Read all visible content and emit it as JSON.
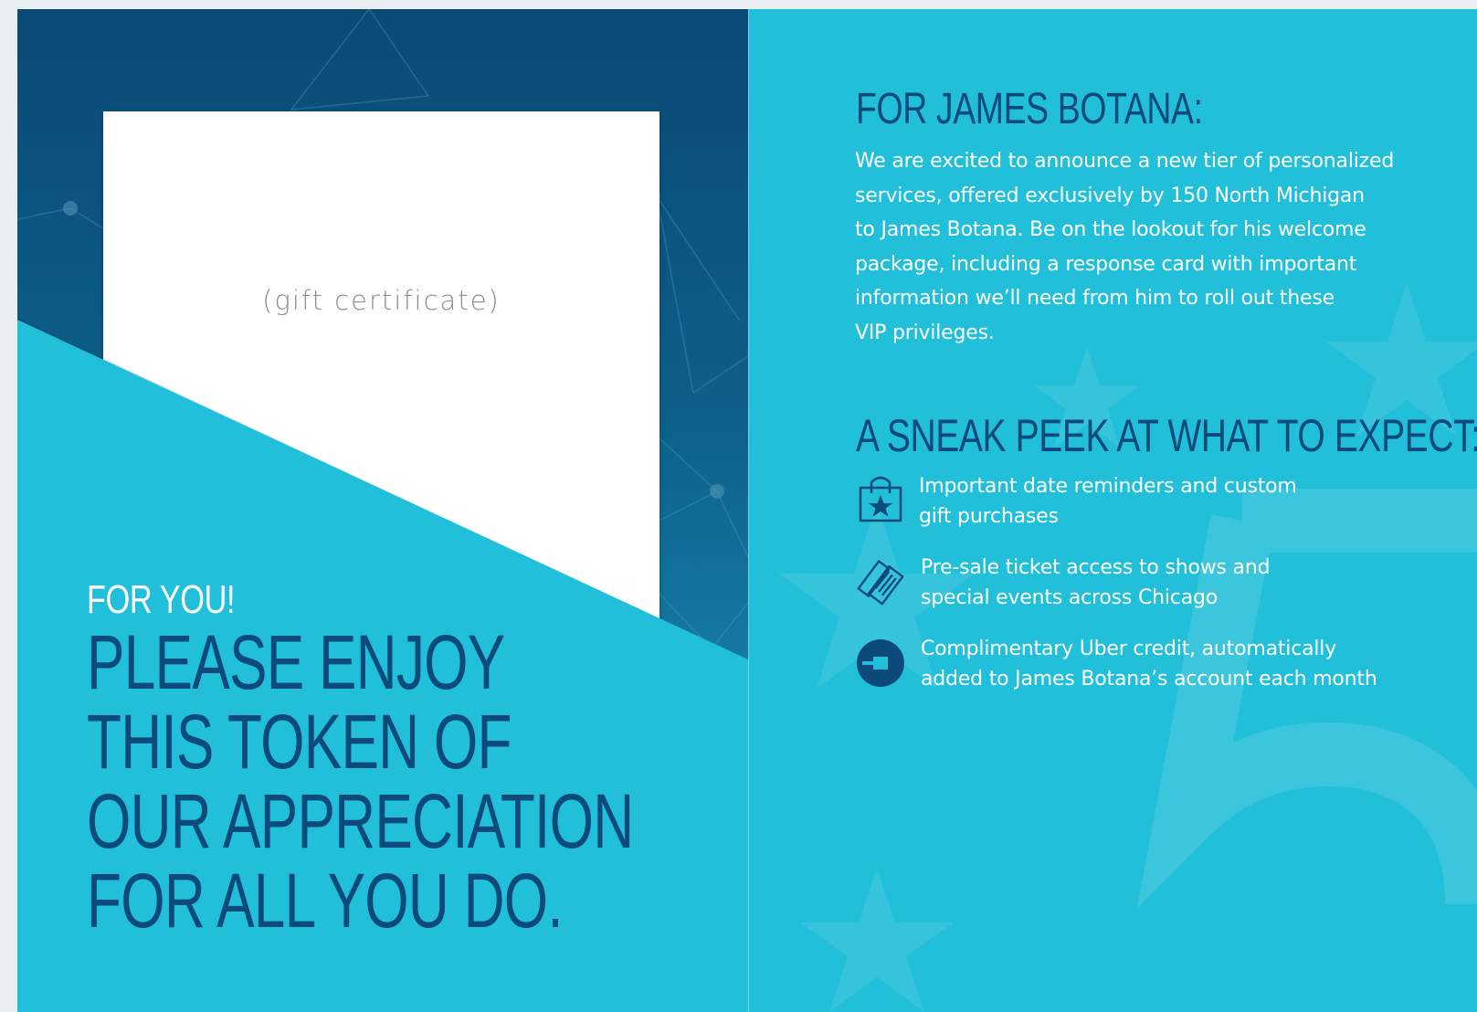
{
  "left": {
    "certificate_label": "(gift certificate)",
    "for_you": "FOR YOU!",
    "headline_lines": [
      "PLEASE ENJOY",
      "THIS TOKEN OF",
      "OUR APPRECIATION",
      "FOR ALL YOU DO."
    ]
  },
  "right": {
    "heading": "FOR JAMES BOTANA:",
    "intro_lines": [
      "We are excited to announce a new tier of personalized",
      "services, offered exclusively by 150 North Michigan",
      "to James Botana. Be on the lookout for his welcome",
      "package, including a response card with important",
      "information we’ll need from him to roll out these",
      "VIP privileges."
    ],
    "subheading": "A SNEAK PEEK AT WHAT TO EXPECT:",
    "items": [
      {
        "icon": "shopping-bag-star-icon",
        "lines": [
          "Important date reminders and custom",
          "gift purchases"
        ]
      },
      {
        "icon": "tickets-icon",
        "lines": [
          "Pre-sale ticket access to shows and",
          "special events across Chicago"
        ]
      },
      {
        "icon": "uber-icon",
        "lines": [
          "Complimentary Uber credit, automatically",
          "added to James Botana’s account each month"
        ]
      }
    ]
  },
  "colors": {
    "page_bg": "#21bfd9",
    "navy": "#0b4a7a",
    "dark_gradient_top": "#0a4a76",
    "white": "#ffffff"
  }
}
